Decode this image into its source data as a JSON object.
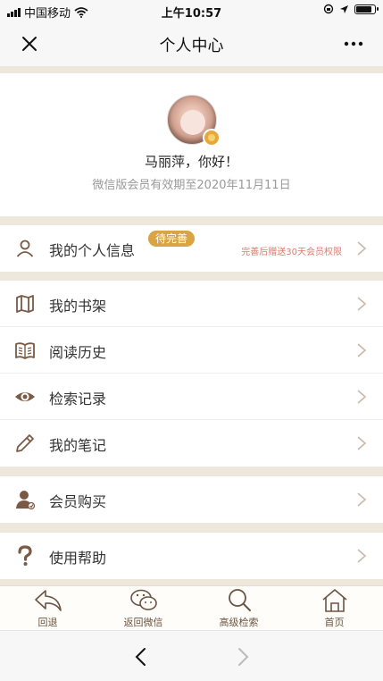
{
  "status": {
    "carrier": "中国移动",
    "time": "上午10:57",
    "battery_level": 0.9
  },
  "nav": {
    "title": "个人中心"
  },
  "profile": {
    "name": "马丽萍，你好！",
    "expire": "微信版会员有效期至2020年11月11日"
  },
  "personal_info": {
    "label": "我的个人信息",
    "badge": "待完善",
    "promo": "完善后赠送30天会员权限"
  },
  "menu": {
    "bookshelf": "我的书架",
    "history": "阅读历史",
    "search_record": "检索记录",
    "notes": "我的笔记",
    "membership": "会员购买",
    "help": "使用帮助"
  },
  "tabs": {
    "back": "回退",
    "wechat": "返回微信",
    "advanced_search": "高级检索",
    "home": "首页"
  },
  "colors": {
    "accent": "#8a6b52",
    "badge": "#d9a441",
    "promo": "#e27a6e"
  }
}
